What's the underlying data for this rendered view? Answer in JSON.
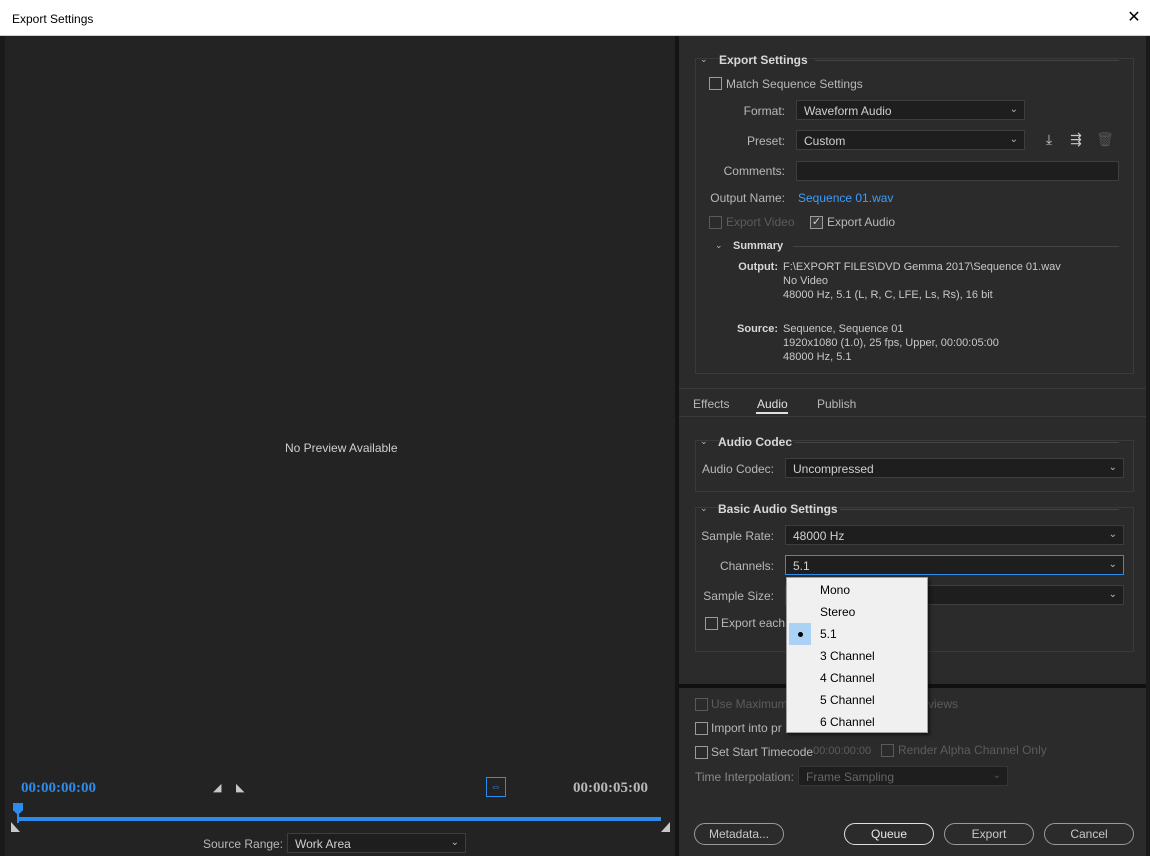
{
  "window": {
    "title": "Export Settings",
    "close_glyph": "✕"
  },
  "preview": {
    "no_preview_text": "No Preview Available",
    "timecode_start": "00:00:00:00",
    "timecode_end": "00:00:05:00",
    "set_in_glyph": "◢",
    "set_out_glyph": "◣",
    "fit_glyph": "⇔",
    "source_range_label": "Source Range:",
    "source_range_value": "Work Area"
  },
  "export_settings": {
    "section_title": "Export Settings",
    "match_sequence_label": "Match Sequence Settings",
    "format_label": "Format:",
    "format_value": "Waveform Audio",
    "preset_label": "Preset:",
    "preset_value": "Custom",
    "comments_label": "Comments:",
    "comments_value": "",
    "output_name_label": "Output Name:",
    "output_name_value": "Sequence 01.wav",
    "export_video_label": "Export Video",
    "export_audio_label": "Export Audio",
    "save_preset_glyph": "⤓",
    "import_preset_glyph": "⇶",
    "delete_preset_glyph": "🗑",
    "summary": {
      "title": "Summary",
      "output_label": "Output:",
      "output_lines": [
        "F:\\EXPORT FILES\\DVD  Gemma 2017\\Sequence 01.wav",
        "No Video",
        "48000 Hz, 5.1 (L, R, C, LFE, Ls, Rs), 16 bit"
      ],
      "source_label": "Source:",
      "source_lines": [
        "Sequence, Sequence 01",
        "1920x1080 (1.0), 25 fps, Upper, 00:00:05:00",
        "48000 Hz, 5.1"
      ]
    }
  },
  "tabs": [
    "Effects",
    "Audio",
    "Publish"
  ],
  "audio": {
    "codec_section_title": "Audio Codec",
    "codec_label": "Audio Codec:",
    "codec_value": "Uncompressed",
    "basic_section_title": "Basic Audio Settings",
    "sample_rate_label": "Sample Rate:",
    "sample_rate_value": "48000 Hz",
    "channels_label": "Channels:",
    "channels_value": "5.1",
    "sample_size_label": "Sample Size:",
    "export_each_label": "Export each c",
    "channel_options": [
      "Mono",
      "Stereo",
      "5.1",
      "3 Channel",
      "4 Channel",
      "5 Channel",
      "6 Channel"
    ]
  },
  "bottom": {
    "use_max_label": "Use Maximum",
    "previews_suffix": "views",
    "import_label": "Import into pr",
    "set_start_tc_label": "Set Start Timecode",
    "start_tc_value": "00:00:00:00",
    "render_alpha_label": "Render Alpha Channel Only",
    "time_interp_label": "Time Interpolation:",
    "time_interp_value": "Frame Sampling"
  },
  "buttons": {
    "metadata": "Metadata...",
    "queue": "Queue",
    "export": "Export",
    "cancel": "Cancel"
  },
  "colors": {
    "accent": "#2d8ceb",
    "link": "#3b9dfc",
    "menu_highlight": "#aad2f5"
  }
}
